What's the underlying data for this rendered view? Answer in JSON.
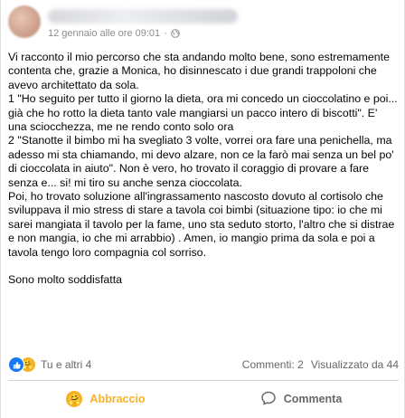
{
  "post": {
    "timestamp": "12 gennaio alle ore 09:01",
    "separator": "·",
    "privacy_icon": "globe-icon",
    "paragraphs": [
      "Vi racconto il mio percorso che sta andando molto bene, sono estremamente contenta che, grazie a Monica, ho disinnescato i due grandi trappoloni che avevo architettato da sola.\n1 \"Ho seguito per tutto il giorno la dieta, ora mi concedo un cioccolatino e poi... già che ho rotto la dieta tanto vale mangiarsi un pacco intero di biscotti\". E' una sciocchezza, me ne rendo conto solo ora\n2 \"Stanotte il bimbo mi ha svegliato 3 volte, vorrei ora fare una penichella,  ma adesso mi sta chiamando, mi devo alzare, non ce la farò mai senza un bel po' di cioccolata in aiuto\". Non è vero, ho trovato il coraggio di provare a fare senza e... si! mi tiro su anche senza cioccolata.\nPoi, ho trovato soluzione all'ingrassamento nascosto dovuto al cortisolo che sviluppava il mio stress di stare a tavola coi bimbi (situazione tipo: io che mi sarei mangiata il tavolo per la fame, uno sta seduto storto, l'altro che si distrae e non mangia, io che mi arrabbio) . Amen, io mangio prima da sola e poi a tavola tengo loro compagnia col sorriso.",
      "Sono molto soddisfatta"
    ]
  },
  "stats": {
    "reaction_icons": [
      "like-icon",
      "care-icon"
    ],
    "reactions_label": "Tu e altri 4",
    "comments": "Commenti: 2",
    "views": "Visualizzato da 44"
  },
  "actions": {
    "react_label": "Abbraccio",
    "comment_label": "Commenta"
  },
  "colors": {
    "care": "#f7b125",
    "like": "#1877f2",
    "muted_text": "#65676b"
  }
}
